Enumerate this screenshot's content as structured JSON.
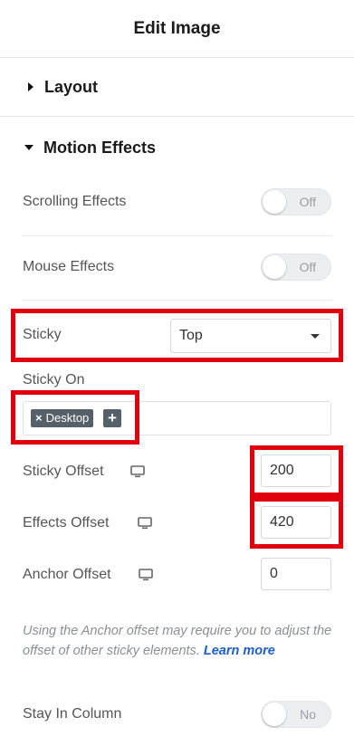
{
  "header": {
    "title": "Edit Image"
  },
  "sections": {
    "layout": {
      "label": "Layout"
    },
    "motion": {
      "label": "Motion Effects"
    }
  },
  "controls": {
    "scrolling_effects": {
      "label": "Scrolling Effects",
      "toggle": "Off"
    },
    "mouse_effects": {
      "label": "Mouse Effects",
      "toggle": "Off"
    },
    "sticky": {
      "label": "Sticky",
      "value": "Top"
    },
    "sticky_on": {
      "label": "Sticky On",
      "tag": "Desktop",
      "tag_remove": "×",
      "add": "+"
    },
    "sticky_offset": {
      "label": "Sticky Offset",
      "value": "200"
    },
    "effects_offset": {
      "label": "Effects Offset",
      "value": "420"
    },
    "anchor_offset": {
      "label": "Anchor Offset",
      "value": "0"
    },
    "note": {
      "text": "Using the Anchor offset may require you to adjust the offset of other sticky elements. ",
      "link": "Learn more"
    },
    "stay_in_column": {
      "label": "Stay In Column",
      "toggle": "No"
    }
  },
  "icons": {
    "device": "monitor-icon",
    "expand": "caret-right-icon",
    "collapse": "caret-down-icon",
    "dropdown": "chevron-down-icon"
  },
  "colors": {
    "highlight": "#e0000e",
    "tag_bg": "#566069",
    "link": "#1d5ecb"
  }
}
